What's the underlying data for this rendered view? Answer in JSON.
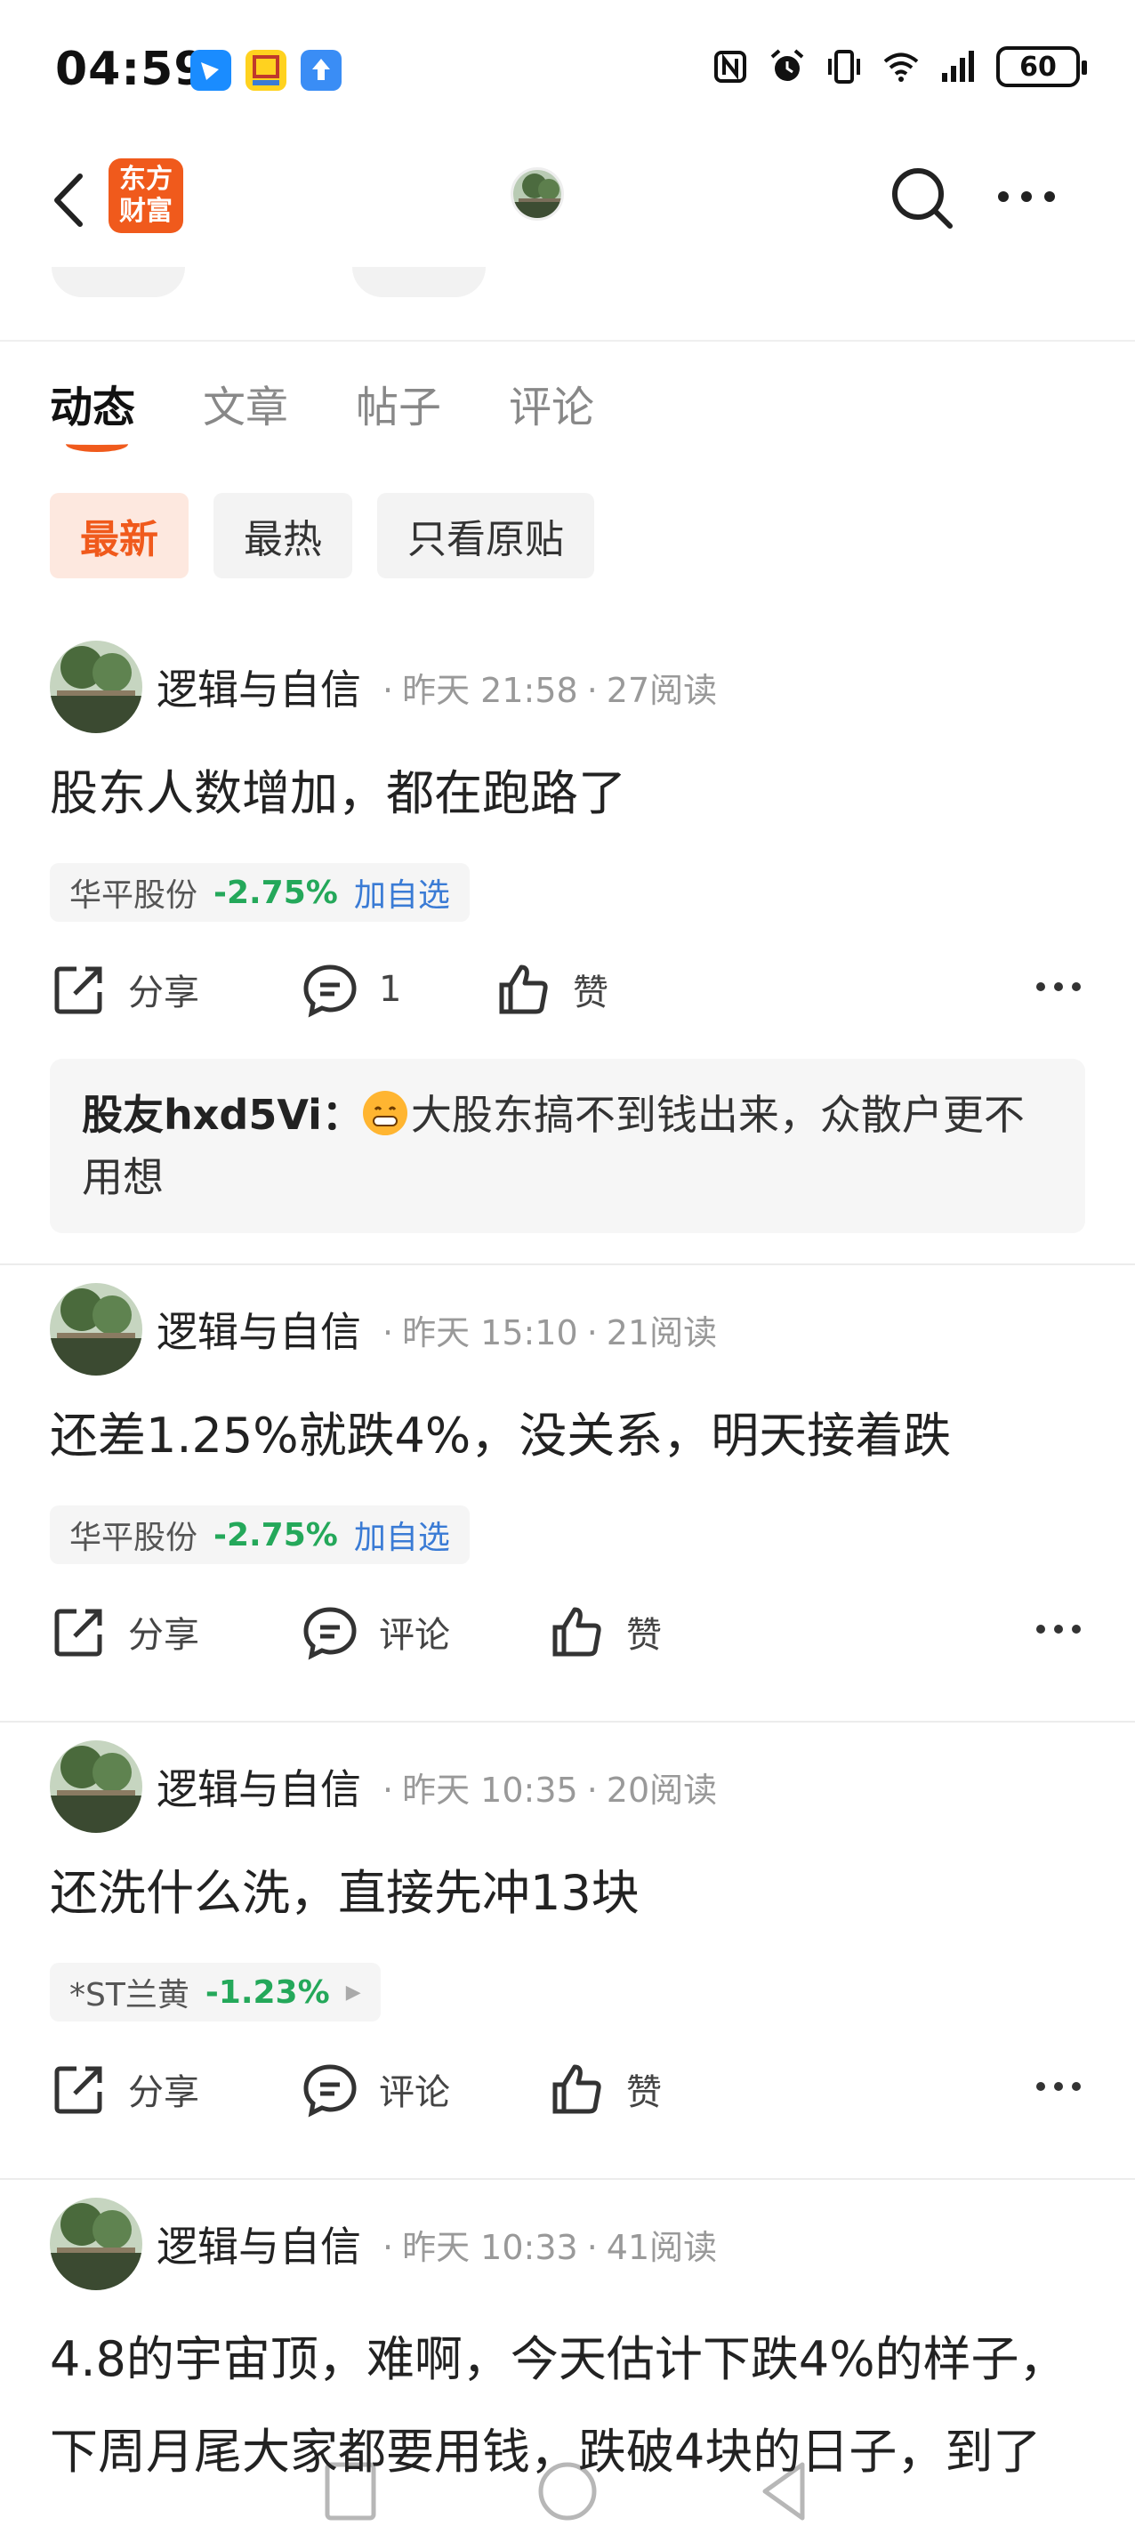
{
  "status_bar": {
    "time": "04:59",
    "battery": "60",
    "app_icons": [
      "feishu-icon",
      "app-yellow-icon",
      "upload-app-icon"
    ],
    "indicator_icons": [
      "nfc-icon",
      "alarm-icon",
      "vibrate-icon",
      "wifi-icon",
      "signal-icon"
    ]
  },
  "nav": {
    "logo_text_line1": "东方",
    "logo_text_line2": "财富"
  },
  "tabs": [
    {
      "label": "动态",
      "active": true
    },
    {
      "label": "文章",
      "active": false
    },
    {
      "label": "帖子",
      "active": false
    },
    {
      "label": "评论",
      "active": false
    }
  ],
  "filters": [
    {
      "label": "最新",
      "active": true
    },
    {
      "label": "最热",
      "active": false
    },
    {
      "label": "只看原贴",
      "active": false
    }
  ],
  "posts": [
    {
      "author": "逻辑与自信",
      "time": "昨天 21:58",
      "reads": "27阅读",
      "text": "股东人数增加，都在跑路了",
      "stock": {
        "name": "华平股份",
        "change": "-2.75%",
        "action": "加自选"
      },
      "actions": {
        "share": "分享",
        "comment": "1",
        "like": "赞"
      },
      "comment": {
        "user": "股友hxd5Vi：",
        "text": "大股东搞不到钱出来，众散户更不用想"
      }
    },
    {
      "author": "逻辑与自信",
      "time": "昨天 15:10",
      "reads": "21阅读",
      "text": "还差1.25%就跌4%，没关系，明天接着跌",
      "stock": {
        "name": "华平股份",
        "change": "-2.75%",
        "action": "加自选"
      },
      "actions": {
        "share": "分享",
        "comment": "评论",
        "like": "赞"
      }
    },
    {
      "author": "逻辑与自信",
      "time": "昨天 10:35",
      "reads": "20阅读",
      "text": "还洗什么洗，直接先冲13块",
      "stock": {
        "name": "*ST兰黄",
        "change": "-1.23%",
        "action": ""
      },
      "actions": {
        "share": "分享",
        "comment": "评论",
        "like": "赞"
      }
    },
    {
      "author": "逻辑与自信",
      "time": "昨天 10:33",
      "reads": "41阅读",
      "text": "4.8的宇宙顶，难啊，今天估计下跌4%的样子，下周月尾大家都要用钱，跌破4块的日子，到了"
    }
  ],
  "colors": {
    "accent": "#f05a1c",
    "down_green": "#24a85a",
    "link_blue": "#3a7bd5"
  }
}
